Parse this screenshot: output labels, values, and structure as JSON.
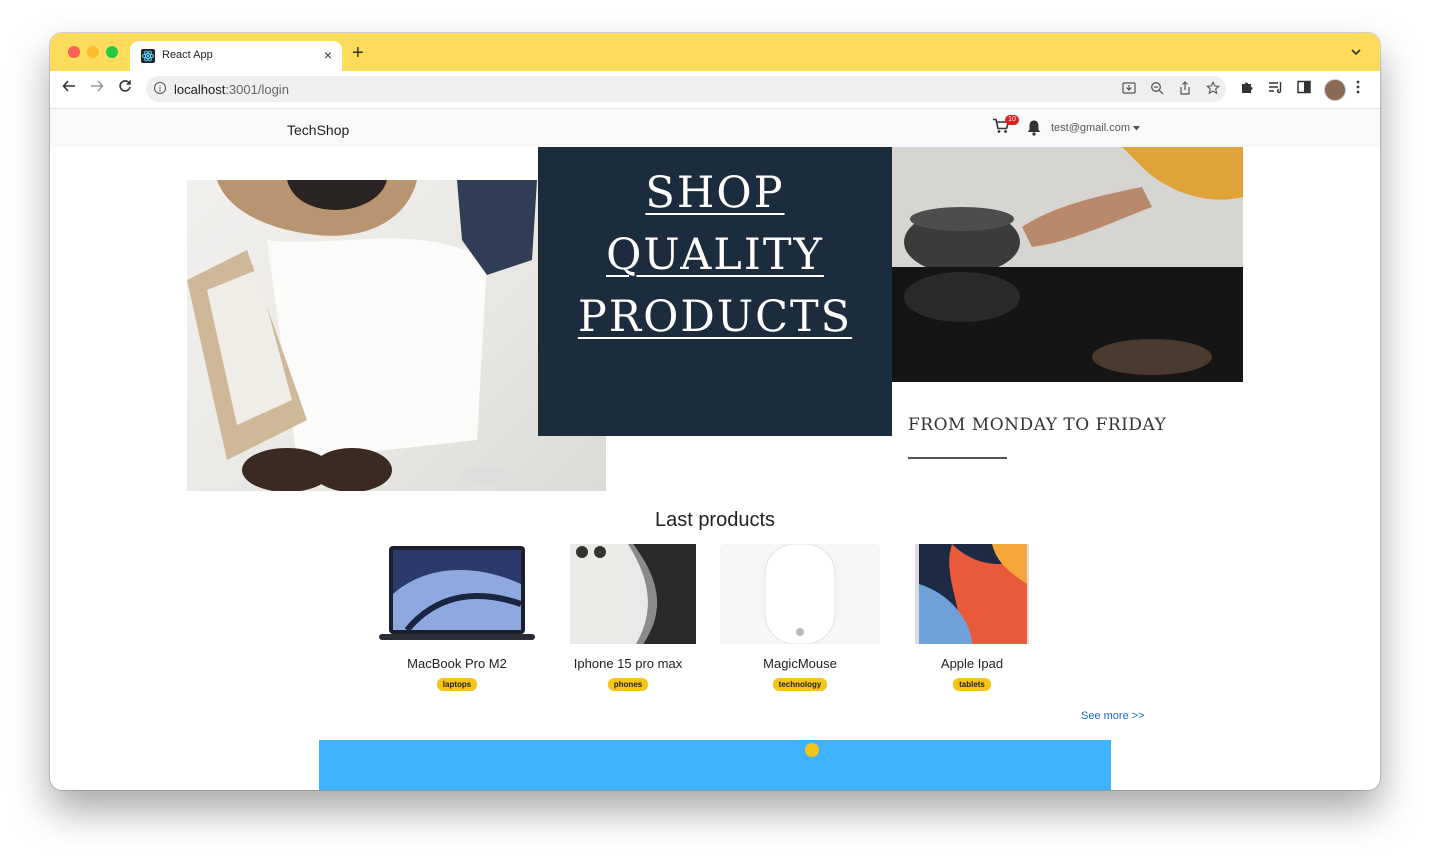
{
  "browser": {
    "tab_title": "React App",
    "tab_close": "×",
    "new_tab": "+",
    "url_host": "localhost",
    "url_path": ":3001/login"
  },
  "navbar": {
    "brand": "TechShop",
    "cart_count": "10",
    "user_email": "test@gmail.com"
  },
  "hero": {
    "line1": "SHOP",
    "line2": "QUALITY",
    "line3": "PRODUCTS",
    "tagline": "FROM MONDAY TO FRIDAY"
  },
  "products": {
    "title": "Last products",
    "items": [
      {
        "name": "MacBook Pro M2",
        "category": "laptops"
      },
      {
        "name": "Iphone 15 pro max",
        "category": "phones"
      },
      {
        "name": "MagicMouse",
        "category": "technology"
      },
      {
        "name": "Apple Ipad",
        "category": "tablets"
      }
    ],
    "see_more": "See more >>"
  },
  "colors": {
    "tab_bar": "#fddc5c",
    "hero_panel": "#1b2d3c",
    "badge": "#f5c518",
    "banner": "#3fb3ff",
    "link": "#1a66d4"
  }
}
